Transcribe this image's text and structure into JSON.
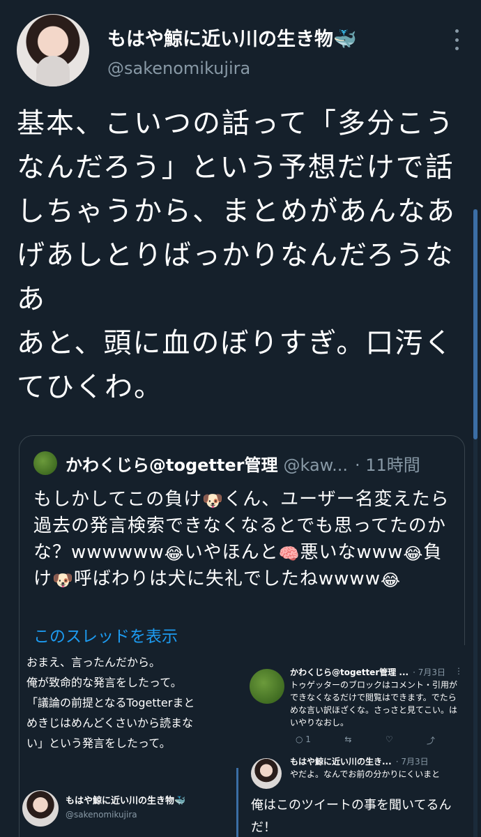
{
  "header": {
    "display_name": "もはや鯨に近い川の生き物🐳",
    "username": "@sakenomikujira"
  },
  "tweet": {
    "text": "基本、こいつの話って「多分こう\nなんだろう」という予想だけで話\nしちゃうから、まとめがあんなあ\nげあしとりばっかりなんだろうな\nあ\nあと、頭に血のぼりすぎ。口汚く\nてひくわ。"
  },
  "quote": {
    "name": "かわくじら@togetter管理",
    "handle": "@kaw...",
    "time": "· 11時間",
    "text_parts": [
      "もしかしてこの負け",
      "くん、ユーザー名変えたら過去の発言検索できなくなるとでも思ってたのかな？wwwwww",
      "いやほんと",
      "悪いなwww",
      "負け",
      "呼ばわりは犬に失礼でしたねwwww"
    ],
    "emojis": [
      "🐶",
      "😂",
      "🧠",
      "😂",
      "🐶",
      "😂"
    ],
    "show_thread": "このスレッドを表示"
  },
  "embed": {
    "left_text": "おまえ、言ったんだから。\n俺が致命的な発言をしたって。\n「議論の前提となるTogetterまと\nめきじはめんどくさいから読まな\nい」という発言をしたって。",
    "profile_name": "もはや鯨に近い川の生き物🐳",
    "profile_handle": "@sakenomikujira",
    "tweet1": {
      "name": "かわくじら@togetter管理 ...",
      "meta": "· 7月3日",
      "more": "⋮",
      "text": "トゥゲッターのブロックはコメント・引用ができなくなるだけで閲覧はできます。でたらめな言い訳ほざくな。さっさと見てこい。はいやりなおし。",
      "reply_count": "1"
    },
    "tweet2": {
      "name": "もはや鯨に近い川の生き...",
      "meta": "· 7月3日",
      "text": "やだよ。なんでお前の分かりにくいまと",
      "big_text": "俺はこのツイートの事を聞いてるんだ！"
    }
  },
  "colors": {
    "background": "#15202b",
    "secondary_text": "#8899a6",
    "link": "#1d9bf0",
    "border": "#38444d"
  },
  "icons": {
    "more": "more-vertical-icon",
    "whale": "whale-emoji"
  }
}
